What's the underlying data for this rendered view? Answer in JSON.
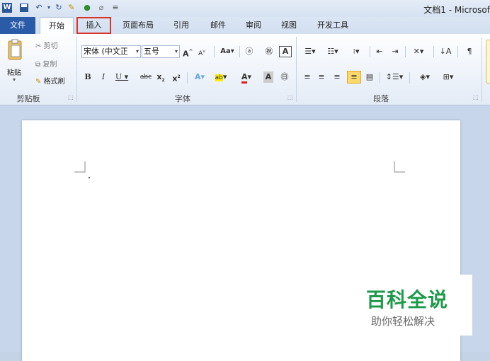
{
  "titlebar": {
    "quick_access": [
      "word-icon",
      "save-icon",
      "undo-icon",
      "redo-icon",
      "format-painter-icon",
      "color-icon",
      "clear-icon",
      "customize-icon"
    ],
    "title": "文档1 - Microsof"
  },
  "tabs": {
    "file": "文件",
    "home": "开始",
    "insert": "插入",
    "layout": "页面布局",
    "references": "引用",
    "mailings": "邮件",
    "review": "审阅",
    "view": "视图",
    "developer": "开发工具"
  },
  "clipboard": {
    "paste": "粘贴",
    "cut": "剪切",
    "copy": "复制",
    "format_painter": "格式刷",
    "label": "剪贴板"
  },
  "font": {
    "font_name": "宋体 (中文正",
    "font_size": "五号",
    "label": "字体"
  },
  "paragraph": {
    "label": "段落"
  },
  "watermark": {
    "title": "百科全说",
    "subtitle": "助你轻松解决"
  },
  "colors": {
    "file_tab": "#2a5ba8",
    "highlight_box": "#d9342b",
    "watermark_green": "#1e9a4a"
  }
}
